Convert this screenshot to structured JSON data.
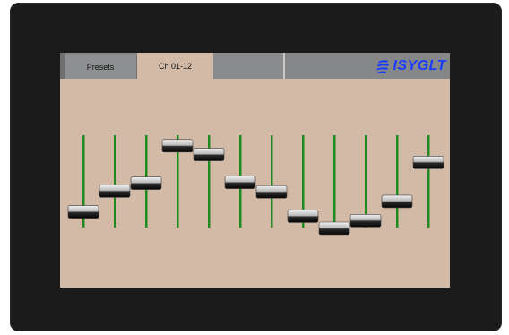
{
  "tabs": [
    {
      "label": "Presets",
      "active": false
    },
    {
      "label": "Ch 01-12",
      "active": true
    },
    {
      "label": "",
      "active": false
    }
  ],
  "logo": {
    "text": "ISYGLT",
    "icon": "swoosh-logo-icon",
    "color": "#1a3cff"
  },
  "colors": {
    "screen_bg": "#d3baa7",
    "track": "#1f8a1f",
    "tab_bar": "#848688"
  },
  "faders": {
    "count": 12,
    "levels": [
      0.19,
      0.43,
      0.52,
      0.95,
      0.85,
      0.53,
      0.42,
      0.14,
      0.0,
      0.09,
      0.31,
      0.76
    ]
  }
}
